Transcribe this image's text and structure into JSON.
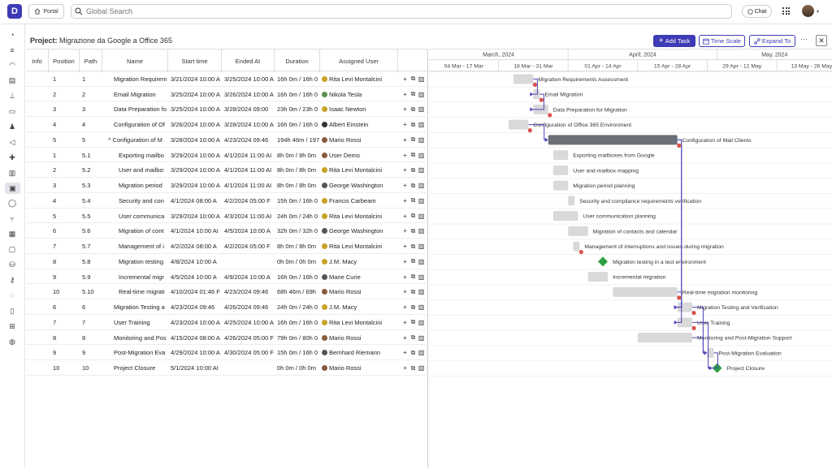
{
  "app": {
    "logo_letter": "D",
    "portal_label": "Portal",
    "search_placeholder": "Global Search",
    "chat_label": "Chat"
  },
  "project": {
    "label": "Project:",
    "name": "Migrazione da Google a Office 365"
  },
  "toolbar": {
    "add_task": "Add Task",
    "time_scale": "Time Scale",
    "expand_to": "Expand To",
    "more": "···",
    "close": "✕"
  },
  "table": {
    "columns": [
      "Info",
      "Position",
      "Path",
      "Name",
      "Start time",
      "Ended At",
      "Duration",
      "Assigned User"
    ],
    "rows": [
      {
        "pos": "1",
        "path": "1",
        "name": "Migration Requirem",
        "indent": 0,
        "start": "3/21/2024 10:00 A",
        "end": "3/25/2024 10:00 A",
        "dur": "16h 0m / 16h 0",
        "user": "Rita Levi Montalcini",
        "ucolor": "#c9a227"
      },
      {
        "pos": "2",
        "path": "2",
        "name": "Email Migration",
        "indent": 0,
        "start": "3/25/2024 10:00 A",
        "end": "3/26/2024 10:00 A",
        "dur": "16h 0m / 16h 0",
        "user": "Nikola Tesla",
        "ucolor": "#5a8f4e"
      },
      {
        "pos": "3",
        "path": "3",
        "name": "Data Preparation fo",
        "indent": 0,
        "start": "3/25/2024 10:00 A",
        "end": "3/28/2024 09:00",
        "dur": "23h 0m / 23h 0",
        "user": "Isaac Newton",
        "ucolor": "#c9a227"
      },
      {
        "pos": "4",
        "path": "4",
        "name": "Configuration of Of",
        "indent": 0,
        "start": "3/26/2024 10:00 A",
        "end": "3/28/2024 10:00 A",
        "dur": "16h 0m / 16h 0",
        "user": "Albert Einstein",
        "ucolor": "#333"
      },
      {
        "pos": "5",
        "path": "5",
        "name": "Configuration of M",
        "indent": 0,
        "expander": "^",
        "start": "3/28/2024 10:00 A",
        "end": "4/23/2024 09:46",
        "dur": "194h 46m / 197",
        "user": "Mario Rossi",
        "ucolor": "#8a5a3c"
      },
      {
        "pos": "1",
        "path": "5.1",
        "name": "Exporting mailbo",
        "indent": 1,
        "start": "3/29/2024 10:00 A",
        "end": "4/1/2024 11:00 AI",
        "dur": "8h 0m / 8h 0m",
        "user": "User Demo",
        "ucolor": "#8a5a3c"
      },
      {
        "pos": "2",
        "path": "5.2",
        "name": "User and mailbo:",
        "indent": 1,
        "start": "3/29/2024 10:00 A",
        "end": "4/1/2024 11:00 AI",
        "dur": "8h 0m / 8h 0m",
        "user": "Rita Levi Montalcini",
        "ucolor": "#c9a227"
      },
      {
        "pos": "3",
        "path": "5.3",
        "name": "Migration period",
        "indent": 1,
        "start": "3/29/2024 10:00 A",
        "end": "4/1/2024 11:00 AI",
        "dur": "8h 0m / 8h 0m",
        "user": "George Washington",
        "ucolor": "#555"
      },
      {
        "pos": "4",
        "path": "5.4",
        "name": "Security and con",
        "indent": 1,
        "start": "4/1/2024 08:00 A",
        "end": "4/2/2024 05:00 F",
        "dur": "15h 0m / 16h 0",
        "user": "Francis Carbeam",
        "ucolor": "#c9a227"
      },
      {
        "pos": "5",
        "path": "5.5",
        "name": "User communica",
        "indent": 1,
        "start": "3/29/2024 10:00 A",
        "end": "4/3/2024 11:00 AI",
        "dur": "24h 0m / 24h 0",
        "user": "Rita Levi Montalcini",
        "ucolor": "#c9a227"
      },
      {
        "pos": "6",
        "path": "5.6",
        "name": "Migration of cont",
        "indent": 1,
        "start": "4/1/2024 10:00 AI",
        "end": "4/5/2024 10:00 A",
        "dur": "32h 0m / 32h 0",
        "user": "George Washington",
        "ucolor": "#555"
      },
      {
        "pos": "7",
        "path": "5.7",
        "name": "Management of i",
        "indent": 1,
        "start": "4/2/2024 08:00 A",
        "end": "4/2/2024 05:00 F",
        "dur": "8h 0m / 8h 0m",
        "user": "Rita Levi Montalcini",
        "ucolor": "#c9a227"
      },
      {
        "pos": "8",
        "path": "5.8",
        "name": "Migration testing",
        "indent": 1,
        "start": "4/8/2024 10:00 A",
        "end": "",
        "dur": "0h 0m / 0h 0m",
        "user": "J.M. Macy",
        "ucolor": "#c9a227"
      },
      {
        "pos": "9",
        "path": "5.9",
        "name": "Incremental migr",
        "indent": 1,
        "start": "4/5/2024 10:00 A",
        "end": "4/9/2024 10:00 A",
        "dur": "16h 0m / 16h 0",
        "user": "Marie Curie",
        "ucolor": "#555"
      },
      {
        "pos": "10",
        "path": "5.10",
        "name": "Real-time migrati",
        "indent": 1,
        "start": "4/10/2024 01:46 F",
        "end": "4/23/2024 09:46",
        "dur": "68h 46m / 69h",
        "user": "Mario Rossi",
        "ucolor": "#8a5a3c"
      },
      {
        "pos": "6",
        "path": "6",
        "name": "Migration Testing a",
        "indent": 0,
        "start": "4/23/2024 09:46",
        "end": "4/26/2024 09:46",
        "dur": "24h 0m / 24h 0",
        "user": "J.M. Macy",
        "ucolor": "#c9a227"
      },
      {
        "pos": "7",
        "path": "7",
        "name": "User Training",
        "indent": 0,
        "start": "4/23/2024 10:00 A",
        "end": "4/25/2024 10:00 A",
        "dur": "16h 0m / 16h 0",
        "user": "Rita Levi Montalcini",
        "ucolor": "#c9a227"
      },
      {
        "pos": "8",
        "path": "8",
        "name": "Monitoring and Pos",
        "indent": 0,
        "start": "4/15/2024 08:00 A",
        "end": "4/26/2024 05:00 F",
        "dur": "79h 0m / 80h 0",
        "user": "Mario Rossi",
        "ucolor": "#8a5a3c"
      },
      {
        "pos": "9",
        "path": "9",
        "name": "Post-Migration Eva",
        "indent": 0,
        "start": "4/29/2024 10:00 A",
        "end": "4/30/2024 05:00 F",
        "dur": "15h 0m / 16h 0",
        "user": "Bernhard Riemann",
        "ucolor": "#555"
      },
      {
        "pos": "10",
        "path": "10",
        "name": "Project Closure",
        "indent": 0,
        "start": "5/1/2024 10:00 AI",
        "end": "",
        "dur": "0h 0m / 0h 0m",
        "user": "Mario Rossi",
        "ucolor": "#8a5a3c"
      }
    ]
  },
  "gantt": {
    "months": [
      {
        "label": "March, 2024"
      },
      {
        "label": "April, 2024"
      },
      {
        "label": "May, 2024"
      }
    ],
    "weeks": [
      "04 Mar - 17 Mar",
      "18 Mar - 31 Mar",
      "01 Apr - 14 Apr",
      "15 Apr - 28 Apr",
      "29 Apr - 12 May",
      "13 May - 26 May"
    ],
    "tasks": [
      {
        "label": "Migration Requirements Assessment",
        "start": "2024-03-21",
        "end": "2024-03-25",
        "kind": "bar"
      },
      {
        "label": "Email Migration",
        "start": "2024-03-25",
        "end": "2024-03-26",
        "kind": "bar"
      },
      {
        "label": "Data Preparation for Migration",
        "start": "2024-03-25",
        "end": "2024-03-28",
        "kind": "bar"
      },
      {
        "label": "Configuration of Office 365 Environment",
        "start": "2024-03-20",
        "end": "2024-03-24",
        "kind": "bar"
      },
      {
        "label": "Configuration of Mail Clients",
        "start": "2024-03-28",
        "end": "2024-04-23",
        "kind": "summary"
      },
      {
        "label": "Exporting mailboxes from Google",
        "start": "2024-03-29",
        "end": "2024-04-01",
        "kind": "bar"
      },
      {
        "label": "User and mailbox mapping",
        "start": "2024-03-29",
        "end": "2024-04-01",
        "kind": "bar"
      },
      {
        "label": "Migration period planning",
        "start": "2024-03-29",
        "end": "2024-04-01",
        "kind": "bar"
      },
      {
        "label": "Security and compliance requirements verification",
        "start": "2024-04-01",
        "end": "2024-04-02",
        "kind": "bar"
      },
      {
        "label": "User communication planning",
        "start": "2024-03-29",
        "end": "2024-04-03",
        "kind": "bar"
      },
      {
        "label": "Migration of contacts and calendar",
        "start": "2024-04-01",
        "end": "2024-04-05",
        "kind": "bar"
      },
      {
        "label": "Management of interruptions and issues during migration",
        "start": "2024-04-02",
        "end": "2024-04-03",
        "kind": "bar"
      },
      {
        "label": "Migration testing in a test environment",
        "start": "2024-04-08",
        "end": "2024-04-08",
        "kind": "milestone"
      },
      {
        "label": "Incremental migration",
        "start": "2024-04-05",
        "end": "2024-04-09",
        "kind": "bar"
      },
      {
        "label": "Real-time migration monitoring",
        "start": "2024-04-10",
        "end": "2024-04-23",
        "kind": "bar"
      },
      {
        "label": "Migration Testing and Verification",
        "start": "2024-04-23",
        "end": "2024-04-26",
        "kind": "bar"
      },
      {
        "label": "User Training",
        "start": "2024-04-23",
        "end": "2024-04-26",
        "kind": "bar"
      },
      {
        "label": "Monitoring and Post-Migration Support",
        "start": "2024-04-15",
        "end": "2024-04-26",
        "kind": "bar"
      },
      {
        "label": "Post-Migration Evaluation",
        "start": "2024-04-29",
        "end": "2024-04-30",
        "kind": "bar"
      },
      {
        "label": "Project Closure",
        "start": "2024-05-01",
        "end": "2024-05-01",
        "kind": "milestone"
      }
    ],
    "links": [
      [
        0,
        1
      ],
      [
        1,
        2
      ],
      [
        3,
        4
      ],
      [
        4,
        15
      ],
      [
        4,
        16
      ],
      [
        14,
        15
      ],
      [
        15,
        18
      ],
      [
        17,
        18
      ],
      [
        18,
        19
      ],
      [
        16,
        19
      ]
    ],
    "red_markers": [
      0,
      1,
      2,
      3,
      4,
      11,
      14,
      15,
      16
    ]
  },
  "colors": {
    "accent": "#3d3bb5",
    "bar": "#d9d9d9",
    "summary": "#6b6f78",
    "milestone": "#2ea043",
    "link": "#4b43b8",
    "marker": "#d9534f"
  },
  "rail_icons": [
    "dashboard-icon",
    "list-icon",
    "wifi-icon",
    "database-icon",
    "org-chart-icon",
    "clipboard-icon",
    "users-icon",
    "megaphone-icon",
    "puzzle-icon",
    "stack-icon",
    "gallery-icon",
    "check-circle-icon",
    "branch-icon",
    "layout-icon",
    "image-icon",
    "network-icon",
    "key-icon",
    "chat-bubble-icon",
    "document-icon",
    "sitemap-icon",
    "globe-icon"
  ]
}
